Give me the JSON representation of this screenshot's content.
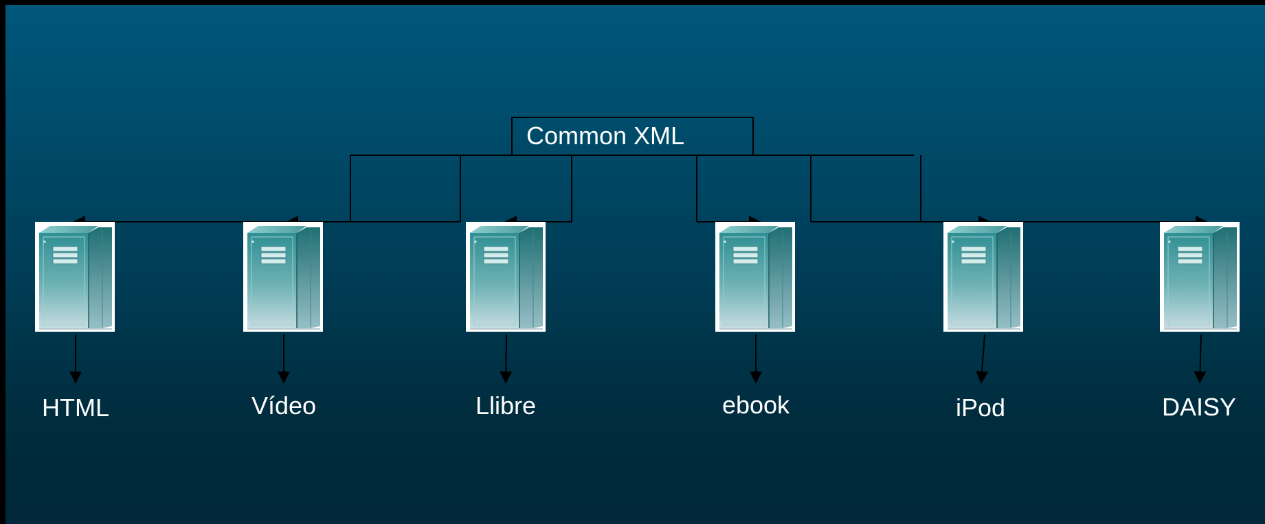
{
  "diagram": {
    "root": {
      "label": "Common XML"
    },
    "outputs": [
      {
        "id": "html",
        "label": "HTML",
        "icon": "server-icon"
      },
      {
        "id": "video",
        "label": "Vídeo",
        "icon": "server-icon"
      },
      {
        "id": "llibre",
        "label": "Llibre",
        "icon": "server-icon"
      },
      {
        "id": "ebook",
        "label": "ebook",
        "icon": "server-icon"
      },
      {
        "id": "ipod",
        "label": "iPod",
        "icon": "server-icon"
      },
      {
        "id": "daisy",
        "label": "DAISY",
        "icon": "server-icon"
      }
    ]
  },
  "colors": {
    "background_top": "#00577a",
    "background_bottom": "#00283a",
    "line": "#000000",
    "text": "#ffffff"
  }
}
